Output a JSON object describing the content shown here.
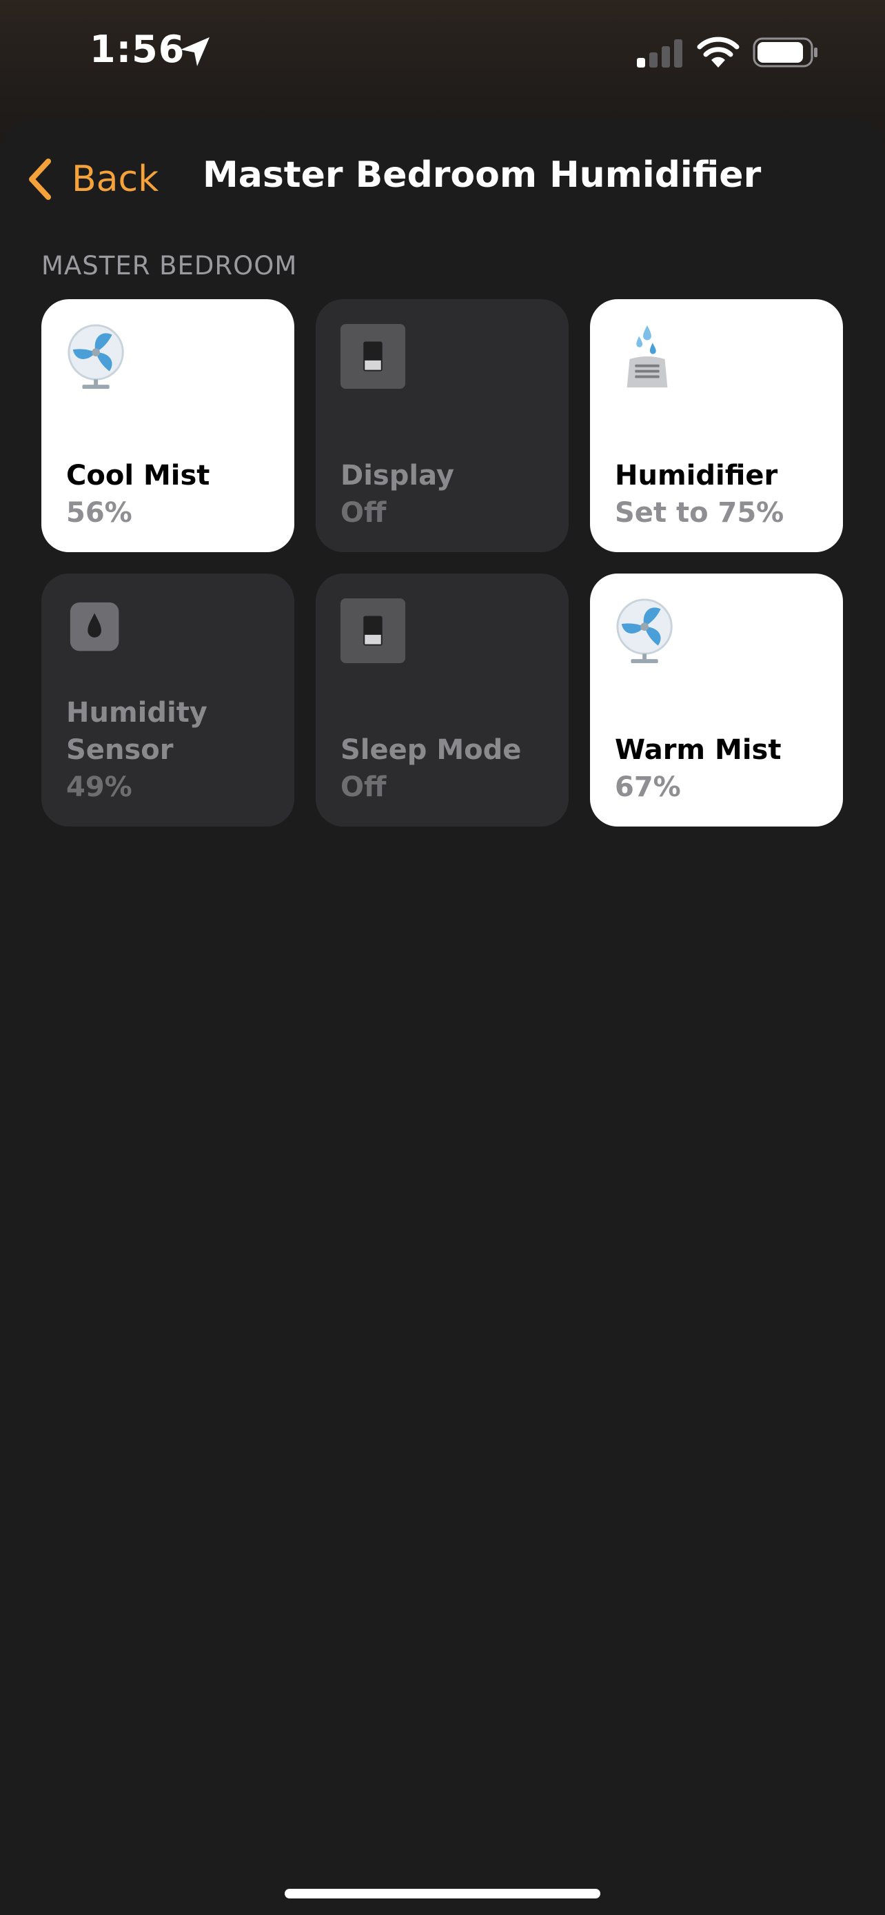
{
  "status_bar": {
    "time": "1:56",
    "icons": [
      "location-arrow-icon",
      "cellular-signal-icon",
      "wifi-icon",
      "battery-icon"
    ]
  },
  "nav": {
    "back_label": "Back",
    "title": "Master Bedroom Humidifier"
  },
  "section": {
    "header": "MASTER BEDROOM"
  },
  "tiles": [
    {
      "name": "Cool Mist",
      "status": "56%",
      "icon": "fan-icon",
      "state": "on"
    },
    {
      "name": "Display",
      "status": "Off",
      "icon": "switch-icon",
      "state": "off"
    },
    {
      "name": "Humidifier",
      "status": "Set to 75%",
      "icon": "humidifier-icon",
      "state": "on"
    },
    {
      "name": "Humidity Sensor",
      "status": "49%",
      "icon": "humidity-drop-icon",
      "state": "off"
    },
    {
      "name": "Sleep Mode",
      "status": "Off",
      "icon": "switch-icon",
      "state": "off"
    },
    {
      "name": "Warm Mist",
      "status": "67%",
      "icon": "fan-icon",
      "state": "on"
    }
  ],
  "colors": {
    "accent": "#f5a23b",
    "background": "#1c1c1c",
    "tile_on": "#ffffff",
    "tile_off": "#2c2c2e",
    "fan_blue": "#4a9fd8"
  }
}
